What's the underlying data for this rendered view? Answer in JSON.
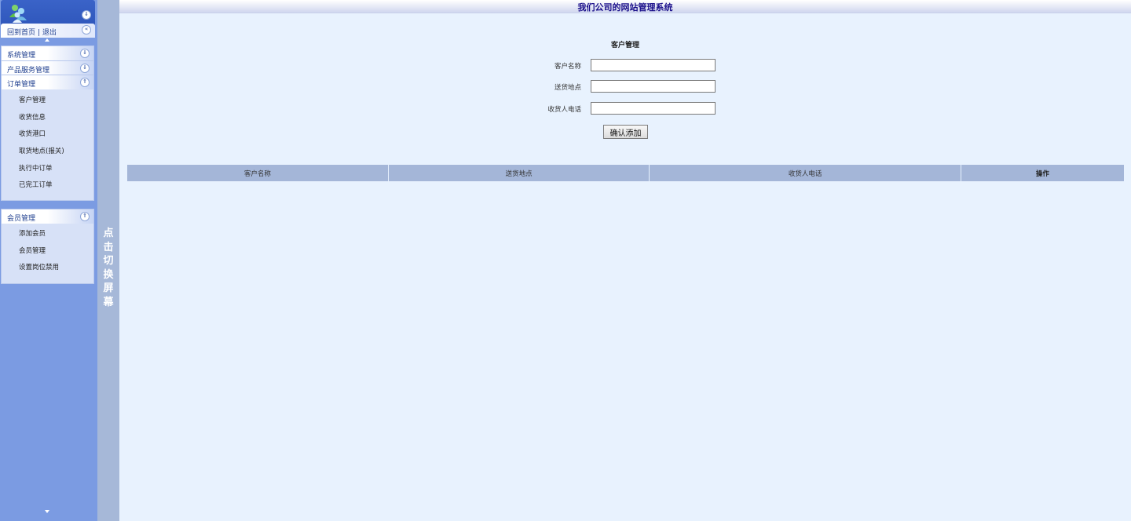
{
  "header": {
    "title": "我们公司的网站管理系统"
  },
  "sidebar": {
    "top_collapse_icon": "double-chevron-down-icon",
    "home_link": "回到首页",
    "separator": "|",
    "logout_link": "退出",
    "groups": [
      {
        "title": "系统管理",
        "state": "collapsed",
        "items": []
      },
      {
        "title": "产品服务管理",
        "state": "collapsed",
        "items": []
      },
      {
        "title": "订单管理",
        "state": "expanded",
        "items": [
          "客户管理",
          "收货信息",
          "收货港口",
          "取货地点(报关)",
          "执行中订单",
          "已完工订单"
        ]
      },
      {
        "title": "会员管理",
        "state": "expanded",
        "items": [
          "添加会员",
          "会员管理",
          "设置岗位禁用"
        ]
      }
    ]
  },
  "toggle_bar": {
    "label": "点击切换屏幕"
  },
  "form": {
    "title": "客户管理",
    "fields": [
      {
        "label": "客户名称",
        "value": ""
      },
      {
        "label": "送货地点",
        "value": ""
      },
      {
        "label": "收货人电话",
        "value": ""
      }
    ],
    "submit_label": "确认添加"
  },
  "table": {
    "columns": [
      "客户名称",
      "送货地点",
      "收货人电话",
      "操作"
    ],
    "rows": []
  },
  "colors": {
    "sidebar_bg": "#7b9be2",
    "toggle_bar_bg": "#a6b8d8",
    "content_bg": "#e8f2fe",
    "header_title": "#1a0f8a",
    "table_header_bg": "#a4b6d8"
  }
}
